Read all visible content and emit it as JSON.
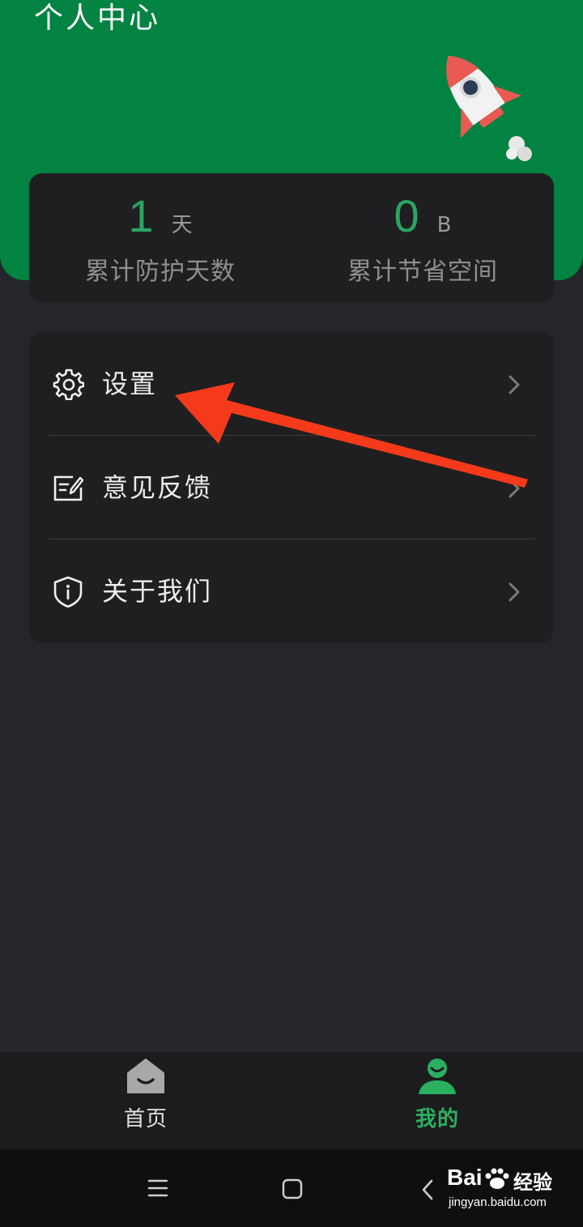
{
  "header": {
    "title": "个人中心"
  },
  "stats": [
    {
      "value": "1",
      "unit": "天",
      "label": "累计防护天数"
    },
    {
      "value": "0",
      "unit": "B",
      "label": "累计节省空间"
    }
  ],
  "menu": {
    "items": [
      {
        "label": "设置",
        "icon": "gear-icon"
      },
      {
        "label": "意见反馈",
        "icon": "feedback-icon"
      },
      {
        "label": "关于我们",
        "icon": "shield-info-icon"
      }
    ]
  },
  "tabbar": {
    "items": [
      {
        "label": "首页",
        "icon": "home-icon",
        "active": false
      },
      {
        "label": "我的",
        "icon": "user-icon",
        "active": true
      }
    ]
  },
  "colors": {
    "header_green": "#028341",
    "accent_green": "#2aa564",
    "annotation_arrow": "#f43a1a"
  },
  "watermark": {
    "brand": "Bai",
    "brand_suffix": "经验",
    "url": "jingyan.baidu.com"
  }
}
